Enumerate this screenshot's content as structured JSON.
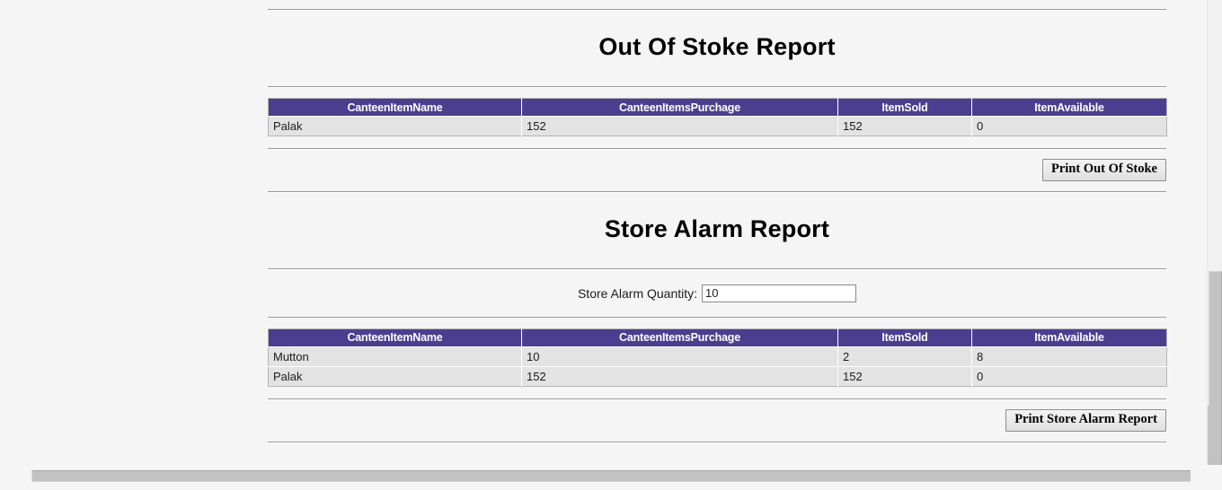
{
  "out_of_stock": {
    "title": "Out Of Stoke Report",
    "columns": [
      "CanteenItemName",
      "CanteenItemsPurchage",
      "ItemSold",
      "ItemAvailable"
    ],
    "rows": [
      {
        "name": "Palak",
        "purchase": "152",
        "sold": "152",
        "available": "0"
      }
    ],
    "print_button": "Print Out Of Stoke"
  },
  "store_alarm": {
    "title": "Store Alarm Report",
    "quantity_label": "Store Alarm Quantity:",
    "quantity_value": "10",
    "quantity_placeholder": "",
    "columns": [
      "CanteenItemName",
      "CanteenItemsPurchage",
      "ItemSold",
      "ItemAvailable"
    ],
    "rows": [
      {
        "name": "Mutton",
        "purchase": "10",
        "sold": "2",
        "available": "8"
      },
      {
        "name": "Palak",
        "purchase": "152",
        "sold": "152",
        "available": "0"
      }
    ],
    "print_button": "Print Store Alarm Report"
  },
  "colors": {
    "header_purple": "#4c3e8f",
    "row_gray": "#e3e3e3",
    "page_background": "#f5f5f5",
    "scrollbar_thumb": "#c2c2c2"
  }
}
